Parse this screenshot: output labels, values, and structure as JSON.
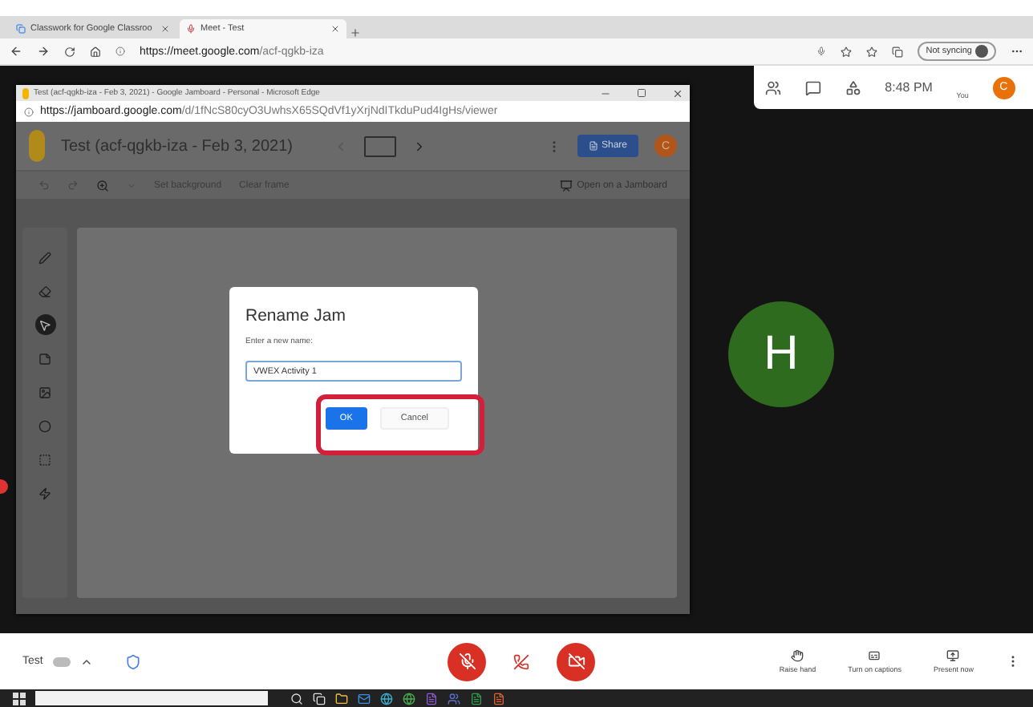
{
  "browser": {
    "tabs": [
      {
        "title": "Classwork for Google Classroo",
        "selected": false
      },
      {
        "title": "Meet - Test",
        "selected": true
      }
    ],
    "url_host": "https://meet.google.com",
    "url_path": "/acf-qgkb-iza",
    "sync_label": "Not syncing"
  },
  "popup": {
    "title": "Test (acf-qgkb-iza - Feb 3, 2021) - Google Jamboard - Personal - Microsoft Edge",
    "url_host": "https://jamboard.google.com",
    "url_path": "/d/1fNcS80cyO3UwhsX65SQdVf1yXrjNdITkduPud4IgHs/viewer"
  },
  "jam": {
    "title": "Test (acf-qgkb-iza - Feb 3, 2021)",
    "share": "Share",
    "avatar": "C",
    "toolbar": [
      "Set background",
      "Clear frame"
    ],
    "open_on": "Open on a Jamboard",
    "tools": [
      {
        "kind": "pen",
        "selected": false
      },
      {
        "kind": "eraser",
        "selected": false
      },
      {
        "kind": "select",
        "selected": true
      },
      {
        "kind": "note",
        "selected": false
      },
      {
        "kind": "image",
        "selected": false
      },
      {
        "kind": "circle",
        "selected": false
      },
      {
        "kind": "textbox",
        "selected": false
      },
      {
        "kind": "laser",
        "selected": false
      }
    ]
  },
  "dialog": {
    "title": "Rename Jam",
    "prompt": "Enter a new name:",
    "value": "VWEX Activity 1",
    "buttons": [
      {
        "label": "OK",
        "kind": "primary"
      },
      {
        "label": "Cancel",
        "kind": "secondary"
      }
    ]
  },
  "meet": {
    "time": "8:48 PM",
    "self_label": "You",
    "self_initial": "C",
    "participant_initial": "H",
    "meeting_name": "Test",
    "actions": [
      {
        "label": "Raise hand",
        "kind": "hand"
      },
      {
        "label": "Turn on captions",
        "kind": "captions"
      },
      {
        "label": "Present now",
        "kind": "present"
      }
    ]
  }
}
